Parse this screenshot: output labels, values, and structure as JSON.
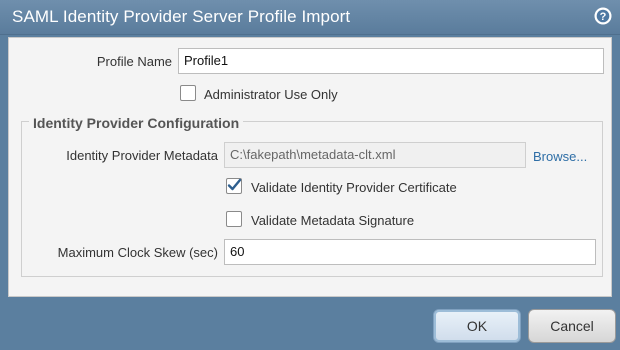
{
  "dialog": {
    "title": "SAML Identity Provider Server Profile Import",
    "help_icon": "help-icon"
  },
  "form": {
    "profile_name_label": "Profile Name",
    "profile_name_value": "Profile1",
    "admin_use_only_label": "Administrator Use Only",
    "admin_use_only_checked": false,
    "idp_config_legend": "Identity Provider Configuration",
    "metadata_label": "Identity Provider Metadata",
    "metadata_value": "C:\\fakepath\\metadata-clt.xml",
    "browse_label": "Browse...",
    "validate_cert_label": "Validate Identity Provider Certificate",
    "validate_cert_checked": true,
    "validate_sig_label": "Validate Metadata Signature",
    "validate_sig_checked": false,
    "clock_skew_label": "Maximum Clock Skew (sec)",
    "clock_skew_value": "60"
  },
  "buttons": {
    "ok_label": "OK",
    "cancel_label": "Cancel"
  },
  "colors": {
    "title_bar": "#6a8aa8",
    "frame": "#5b7f9f",
    "link": "#2e6ea6",
    "checkmark": "#2f5f8f"
  }
}
